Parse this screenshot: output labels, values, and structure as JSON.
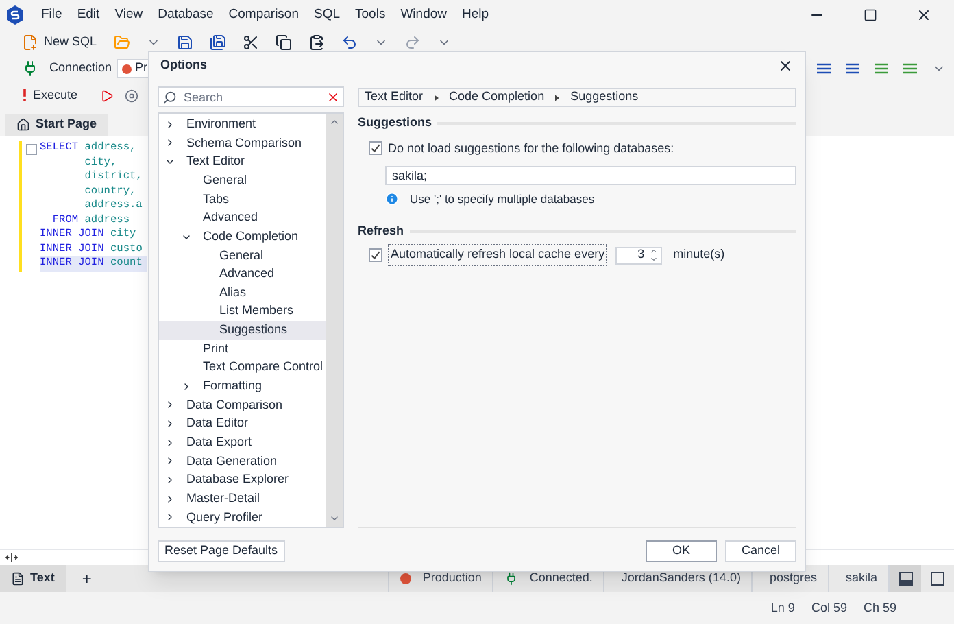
{
  "menu": [
    "File",
    "Edit",
    "View",
    "Database",
    "Comparison",
    "SQL",
    "Tools",
    "Window",
    "Help"
  ],
  "toolbar": {
    "new_sql": "New SQL"
  },
  "connection_bar": {
    "label": "Connection",
    "value": "Pr"
  },
  "run_bar": {
    "execute": "Execute"
  },
  "doc_tabs": [
    {
      "label": "Start Page",
      "selected": false
    }
  ],
  "code_lines": [
    {
      "selected": false,
      "tokens": [
        {
          "kind": "keyword",
          "text": "SELECT"
        },
        {
          "kind": "ident",
          "text": " address,"
        }
      ]
    },
    {
      "selected": false,
      "tokens": [
        {
          "kind": "ident",
          "text": "       city,"
        }
      ]
    },
    {
      "selected": false,
      "tokens": [
        {
          "kind": "ident",
          "text": "       district,"
        }
      ]
    },
    {
      "selected": false,
      "tokens": [
        {
          "kind": "ident",
          "text": "       country,"
        }
      ]
    },
    {
      "selected": false,
      "tokens": [
        {
          "kind": "ident",
          "text": "       address.a"
        }
      ]
    },
    {
      "selected": false,
      "tokens": [
        {
          "kind": "keyword",
          "text": "  FROM"
        },
        {
          "kind": "ident",
          "text": " address"
        }
      ]
    },
    {
      "selected": false,
      "tokens": [
        {
          "kind": "keyword",
          "text": "INNER JOIN"
        },
        {
          "kind": "ident",
          "text": " city"
        }
      ]
    },
    {
      "selected": false,
      "tokens": [
        {
          "kind": "keyword",
          "text": "INNER JOIN"
        },
        {
          "kind": "ident",
          "text": " custo"
        }
      ]
    },
    {
      "selected": true,
      "tokens": [
        {
          "kind": "keyword",
          "text": "INNER JOIN"
        },
        {
          "kind": "ident",
          "text": " count"
        }
      ]
    }
  ],
  "bottom_tabs": [
    {
      "label": "Text",
      "selected": true
    }
  ],
  "add_tab": "+",
  "status_items": [
    {
      "kind": "dot",
      "text": "Production",
      "color": "#e0533a"
    },
    {
      "kind": "plug",
      "text": "Connected."
    },
    {
      "kind": "plain",
      "text": "JordanSanders (14.0)"
    },
    {
      "kind": "plain",
      "text": "postgres"
    },
    {
      "kind": "plain",
      "text": "sakila"
    }
  ],
  "position": [
    "Ln 9",
    "Col 59",
    "Ch 59"
  ],
  "dialog": {
    "title": "Options",
    "search": {
      "placeholder": "Search"
    },
    "tree": [
      {
        "label": "Environment",
        "expanded": false,
        "selected": false
      },
      {
        "label": "Schema Comparison",
        "expanded": false,
        "selected": false
      },
      {
        "label": "Text Editor",
        "expanded": true,
        "selected": false,
        "children": [
          {
            "label": "General",
            "selected": false
          },
          {
            "label": "Tabs",
            "selected": false
          },
          {
            "label": "Advanced",
            "selected": false
          },
          {
            "label": "Code Completion",
            "expanded": true,
            "selected": false,
            "children": [
              {
                "label": "General",
                "selected": false
              },
              {
                "label": "Advanced",
                "selected": false
              },
              {
                "label": "Alias",
                "selected": false
              },
              {
                "label": "List Members",
                "selected": false
              },
              {
                "label": "Suggestions",
                "selected": true
              }
            ]
          },
          {
            "label": "Print",
            "selected": false
          },
          {
            "label": "Text Compare Control",
            "selected": false
          },
          {
            "label": "Formatting",
            "expanded": false,
            "selected": false
          }
        ]
      },
      {
        "label": "Data Comparison",
        "expanded": false,
        "selected": false
      },
      {
        "label": "Data Editor",
        "expanded": false,
        "selected": false
      },
      {
        "label": "Data Export",
        "expanded": false,
        "selected": false
      },
      {
        "label": "Data Generation",
        "expanded": false,
        "selected": false
      },
      {
        "label": "Database Explorer",
        "expanded": false,
        "selected": false
      },
      {
        "label": "Master-Detail",
        "expanded": false,
        "selected": false
      },
      {
        "label": "Query Profiler",
        "expanded": false,
        "selected": false
      }
    ],
    "breadcrumb": [
      "Text Editor",
      "Code Completion",
      "Suggestions"
    ],
    "suggestions": {
      "heading": "Suggestions",
      "checkbox": {
        "label": "Do not load suggestions for the following databases:",
        "checked": true
      },
      "databases": "sakila;",
      "hint": "Use ';' to specify multiple databases"
    },
    "refresh": {
      "heading": "Refresh",
      "checkbox": {
        "label": "Automatically refresh local cache every",
        "checked": true
      },
      "minutes": "3",
      "unit": "minute(s)"
    },
    "buttons": {
      "reset": "Reset Page Defaults",
      "ok": "OK",
      "cancel": "Cancel"
    }
  }
}
